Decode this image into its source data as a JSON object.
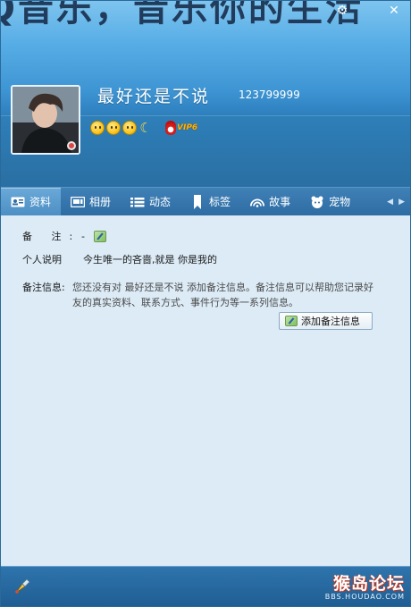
{
  "header": {
    "banner_text": "Q音乐，音乐你的生活",
    "nickname": "最好还是不说",
    "qq_number": "123799999",
    "vip_label": "VIP6",
    "window_controls": {
      "settings_glyph": "⚙",
      "close_glyph": "✕"
    },
    "status_icons": [
      "smiley-icon",
      "smiley-icon",
      "smiley-icon",
      "moon-icon"
    ]
  },
  "tabs": [
    {
      "label": "资料",
      "icon": "profile-card-icon",
      "active": true
    },
    {
      "label": "相册",
      "icon": "photo-album-icon",
      "active": false
    },
    {
      "label": "动态",
      "icon": "feed-list-icon",
      "active": false
    },
    {
      "label": "标签",
      "icon": "bookmark-icon",
      "active": false
    },
    {
      "label": "故事",
      "icon": "story-arcs-icon",
      "active": false
    },
    {
      "label": "宠物",
      "icon": "pet-icon",
      "active": false
    }
  ],
  "tab_nav": {
    "prev_glyph": "◀",
    "next_glyph": "▶"
  },
  "profile": {
    "remark_label": "备 注:",
    "remark_value": "-",
    "signature_label": "个人说明",
    "signature_value": "今生唯一的吝啬,就是 你是我的",
    "remark_info_label": "备注信息:",
    "remark_info_text": "您还没有对 最好还是不说 添加备注信息。备注信息可以帮助您记录好友的真实资料、联系方式、事件行为等一系列信息。",
    "add_remark_button": "添加备注信息"
  },
  "footer": {
    "tool_icon": "brush-tool-icon",
    "watermark_title": "猴岛论坛",
    "watermark_url": "BBS.HOUDAO.COM"
  },
  "colors": {
    "header_top": "#7ec4ef",
    "header_bottom": "#2a73ad",
    "tab_bar": "#2e6da4",
    "content_bg": "#dcebf6",
    "footer": "#1f5e93"
  }
}
